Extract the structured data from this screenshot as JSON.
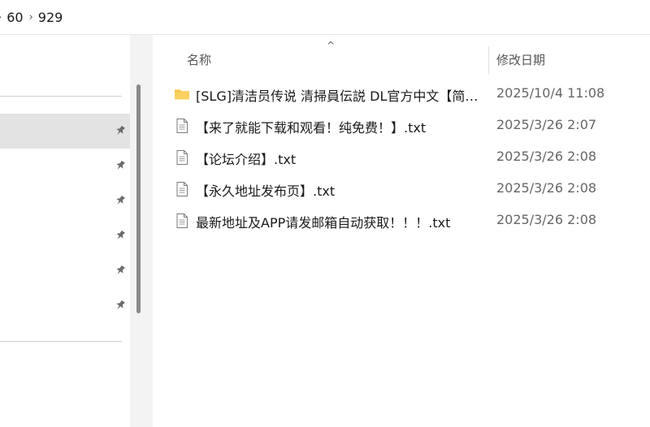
{
  "breadcrumb": {
    "items": [
      "60",
      "929"
    ],
    "separator": "›"
  },
  "columns": {
    "name": "名称",
    "date_modified": "修改日期",
    "sort_indicator": "^"
  },
  "files": [
    {
      "name": "[SLG]清洁员传说  清掃員伝説  DL官方中文【简体中文】",
      "date": "2025/10/4 11:08",
      "type": "folder"
    },
    {
      "name": "【来了就能下载和观看！纯免费！】.txt",
      "date": "2025/3/26 2:07",
      "type": "txt"
    },
    {
      "name": "【论坛介绍】.txt",
      "date": "2025/3/26 2:08",
      "type": "txt"
    },
    {
      "name": "【永久地址发布页】.txt",
      "date": "2025/3/26 2:08",
      "type": "txt"
    },
    {
      "name": "最新地址及APP请发邮箱自动获取！！！.txt",
      "date": "2025/3/26 2:08",
      "type": "txt"
    }
  ],
  "nav": {
    "pinned_count": 6,
    "pin_icon": "pin-icon"
  },
  "colors": {
    "selected_bg": "#e3e3e3",
    "folder": "#f6c445",
    "background": "#f3f3f3"
  }
}
